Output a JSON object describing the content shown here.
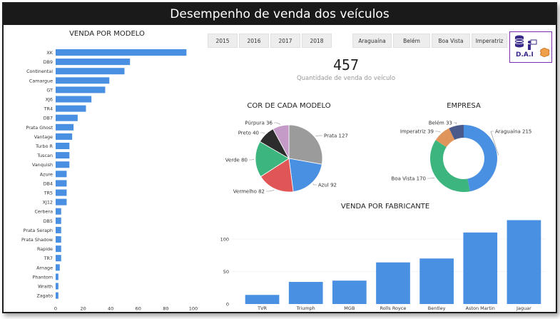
{
  "header": {
    "title": "Desempenho de venda dos veículos"
  },
  "filters": {
    "years": [
      "2015",
      "2016",
      "2017",
      "2018"
    ],
    "cities": [
      "Araguaína",
      "Belém",
      "Boa Vista",
      "Imperatriz"
    ]
  },
  "kpi": {
    "value": "457",
    "label": "Quantidade de venda do veículo"
  },
  "logo": {
    "text": "D.A.I"
  },
  "colors": {
    "bar": "#4a90e2",
    "header": "#1a1a1a",
    "logo_border": "#7a2fb0"
  },
  "chart_data": [
    {
      "type": "bar",
      "orientation": "horizontal",
      "title": "VENDA POR MODELO",
      "categories": [
        "XK",
        "DB9",
        "Continental",
        "Camargue",
        "GT",
        "XJ6",
        "TR4",
        "DB7",
        "Prata Ghost",
        "Vantage",
        "Turbo R",
        "Tuscan",
        "Vanquish",
        "Azure",
        "DB4",
        "TR5",
        "XJ12",
        "Cerbera",
        "DB5",
        "Prata Seraph",
        "Prata Shadow",
        "Rapide",
        "TR7",
        "Arnage",
        "Phantom",
        "Wraith",
        "Zagato"
      ],
      "values": [
        95,
        54,
        50,
        39,
        36,
        26,
        22,
        16,
        13,
        12,
        10,
        10,
        10,
        8,
        8,
        8,
        8,
        4,
        4,
        4,
        4,
        4,
        4,
        3,
        2,
        2,
        2
      ],
      "xlim": [
        0,
        100
      ],
      "xticks": [
        0,
        20,
        40,
        60,
        80,
        100
      ]
    },
    {
      "type": "pie",
      "title": "COR DE CADA MODELO",
      "slices": [
        {
          "label": "Prata",
          "value": 127,
          "color": "#9b9b9b"
        },
        {
          "label": "Azul",
          "value": 92,
          "color": "#4a90e2"
        },
        {
          "label": "Vermelho",
          "value": 82,
          "color": "#e05555"
        },
        {
          "label": "Verde",
          "value": 80,
          "color": "#3cb67e"
        },
        {
          "label": "Preto",
          "value": 40,
          "color": "#2c2c2c"
        },
        {
          "label": "Púrpura",
          "value": 36,
          "color": "#c49ac7"
        }
      ]
    },
    {
      "type": "pie",
      "style": "donut",
      "title": "EMPRESA",
      "slices": [
        {
          "label": "Araguaína",
          "value": 215,
          "color": "#4a90e2"
        },
        {
          "label": "Boa Vista",
          "value": 170,
          "color": "#3cb67e"
        },
        {
          "label": "Imperatriz",
          "value": 39,
          "color": "#e0955a"
        },
        {
          "label": "Belém",
          "value": 33,
          "color": "#4a5a8a"
        }
      ]
    },
    {
      "type": "bar",
      "title": "VENDA POR FABRICANTE",
      "categories": [
        "TVR",
        "Triumph",
        "MGB",
        "Rolls Royce",
        "Bentley",
        "Aston Martin",
        "Jaguar"
      ],
      "values": [
        14,
        34,
        36,
        64,
        70,
        110,
        129
      ],
      "ylim": [
        0,
        135
      ],
      "yticks": [
        0,
        50,
        100
      ]
    }
  ]
}
